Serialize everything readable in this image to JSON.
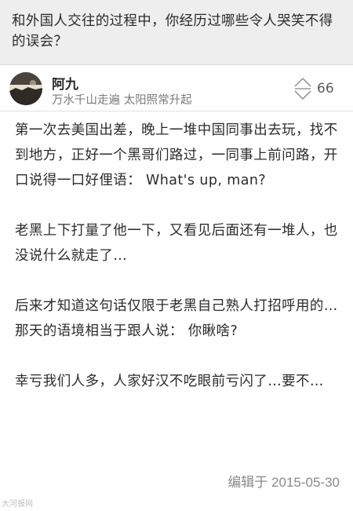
{
  "question": {
    "title": "和外国人交往的过程中，你经历过哪些令人哭笑不得的误会？"
  },
  "author": {
    "name": "阿九",
    "bio": "万水千山走遍 太阳照常升起",
    "avatar_icon": "avatar-photo"
  },
  "votes": {
    "count": "66",
    "icon": "vote-up-down-icon"
  },
  "answer": {
    "paragraphs": [
      "第一次去美国出差，晚上一堆中国同事出去玩，找不到地方，正好一个黑哥们路过，一同事上前问路，开口说得一口好俚语： What's up, man?",
      "老黑上下打量了他一下，又看见后面还有一堆人，也没说什么就走了…",
      "后来才知道这句话仅限于老黑自己熟人打招呼用的…那天的语境相当于跟人说： 你瞅啥?",
      "幸亏我们人多，人家好汉不吃眼前亏闪了…要不…"
    ],
    "edited": "编辑于 2015-05-30"
  },
  "watermark": {
    "text": "大河报网"
  }
}
